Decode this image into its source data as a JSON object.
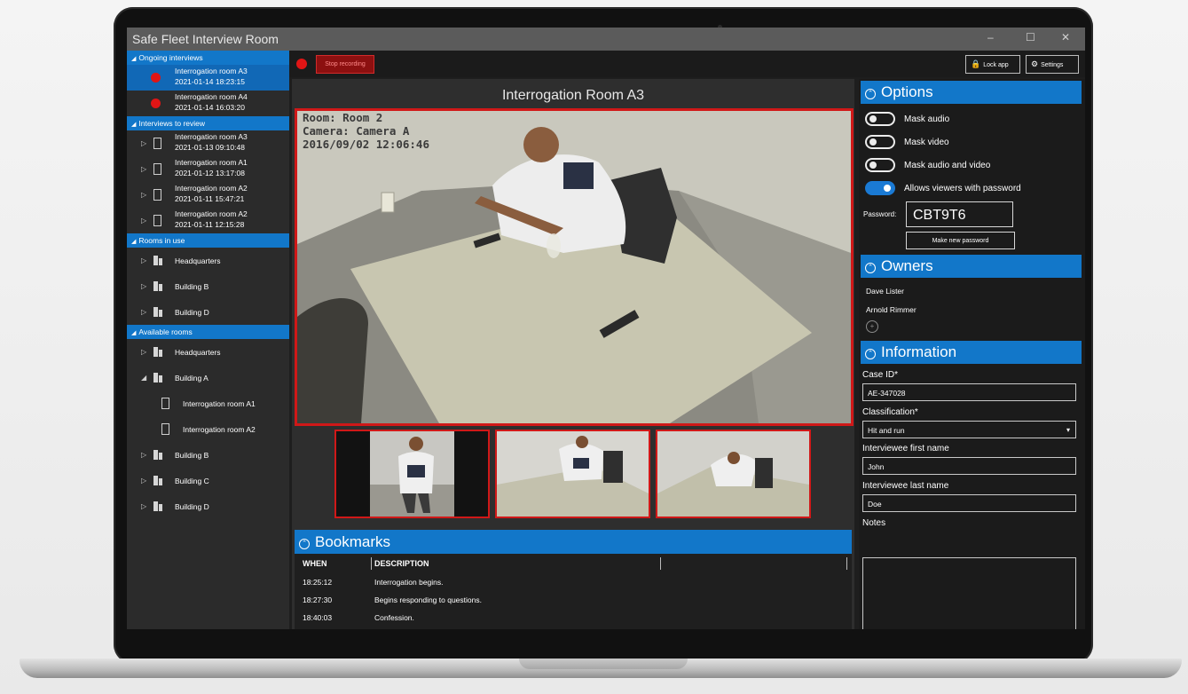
{
  "app": {
    "title": "Safe Fleet Interview Room",
    "minimize": "–",
    "maximize": "☐",
    "close": "✕"
  },
  "sidebar": {
    "ongoing": {
      "label": "Ongoing interviews",
      "items": [
        {
          "name": "Interrogation room A3",
          "time": "2021-01-14 18:23:15"
        },
        {
          "name": "Interrogation room A4",
          "time": "2021-01-14 16:03:20"
        }
      ]
    },
    "review": {
      "label": "Interviews to review",
      "items": [
        {
          "name": "Interrogation room A3",
          "time": "2021-01-13 09:10:48"
        },
        {
          "name": "Interrogation room A1",
          "time": "2021-01-12 13:17:08"
        },
        {
          "name": "Interrogation room A2",
          "time": "2021-01-11 15:47:21"
        },
        {
          "name": "Interrogation room A2",
          "time": "2021-01-11 12:15:28"
        }
      ]
    },
    "in_use": {
      "label": "Rooms in use",
      "items": [
        "Headquarters",
        "Building B",
        "Building D"
      ]
    },
    "available": {
      "label": "Available rooms",
      "headquarters": "Headquarters",
      "building_a": "Building A",
      "rooms": [
        "Interrogation room A1",
        "Interrogation room A2"
      ],
      "others": [
        "Building B",
        "Building C",
        "Building D"
      ]
    }
  },
  "toolbar": {
    "stop_label": "Stop recording",
    "lock_label": "Lock app",
    "settings_label": "Settings"
  },
  "main": {
    "room_title": "Interrogation Room A3",
    "osd": [
      "Room: Room 2",
      "Camera: Camera A",
      "2016/09/02 12:06:46"
    ]
  },
  "bookmarks": {
    "title": "Bookmarks",
    "columns": [
      "WHEN",
      "DESCRIPTION"
    ],
    "rows": [
      {
        "when": "18:25:12",
        "desc": "Interrogation begins."
      },
      {
        "when": "18:27:30",
        "desc": "Begins responding to questions."
      },
      {
        "when": "18:40:03",
        "desc": "Confession."
      }
    ]
  },
  "options": {
    "title": "Options",
    "toggles": [
      {
        "label": "Mask audio",
        "on": false
      },
      {
        "label": "Mask video",
        "on": false
      },
      {
        "label": "Mask audio and video",
        "on": false
      },
      {
        "label": "Allows viewers with password",
        "on": true
      }
    ],
    "password_label": "Password:",
    "password": "CBT9T6",
    "new_password_label": "Make new password"
  },
  "owners": {
    "title": "Owners",
    "names": [
      "Dave Lister",
      "Arnold Rimmer"
    ]
  },
  "information": {
    "title": "Information",
    "case_id_label": "Case ID*",
    "case_id": "AE-347028",
    "classification_label": "Classification*",
    "classification": "Hit and run",
    "first_name_label": "Interviewee first name",
    "first_name": "John",
    "last_name_label": "Interviewee last name",
    "last_name": "Doe",
    "notes_label": "Notes"
  },
  "colors": {
    "accent": "#1277c9",
    "record": "#e01515",
    "video_border": "#d01818"
  }
}
